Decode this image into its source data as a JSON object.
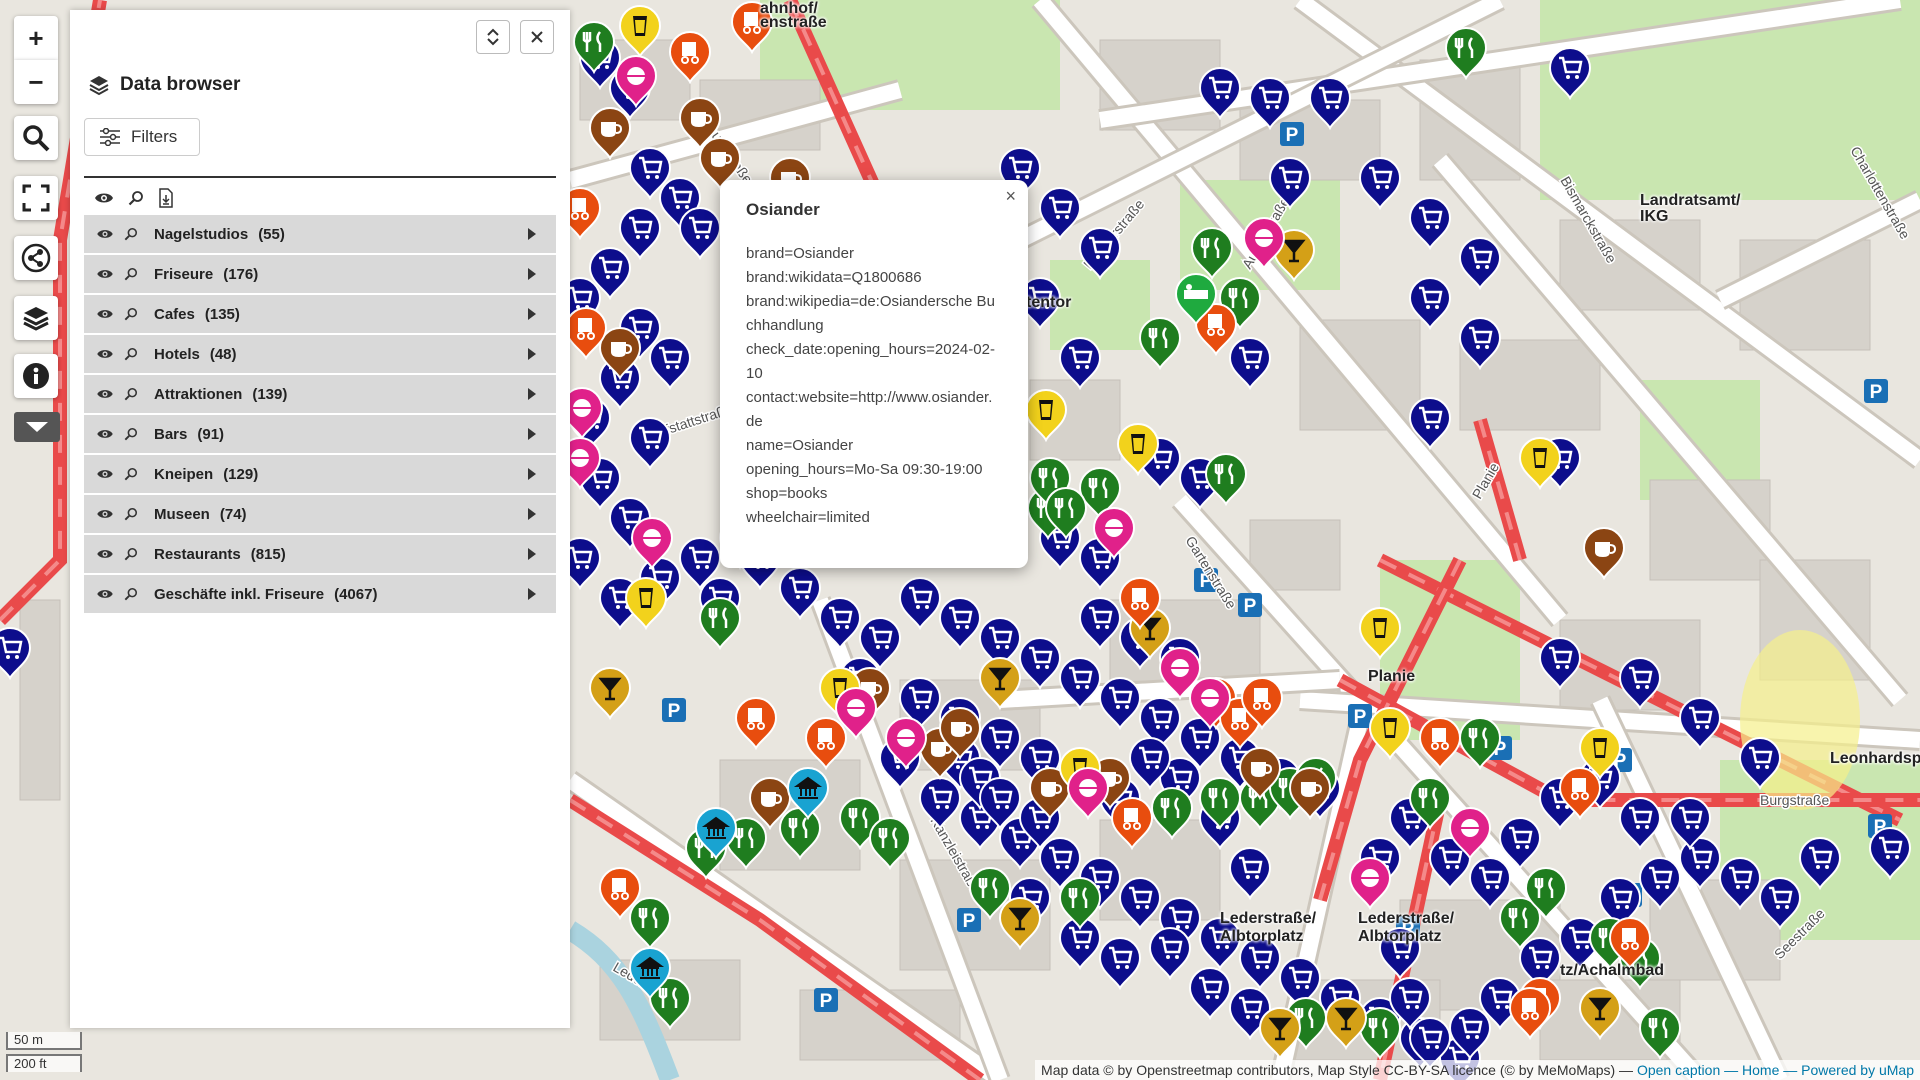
{
  "map": {
    "labels": [
      "Landratsamt/",
      "IKG",
      "Planie",
      "Leonhardsp",
      "Lederstraße/",
      "Albtorplatz",
      "Lederstraße/",
      "Albtorplatz",
      "tz/Achalmbad",
      "tentor",
      "ahnhof/",
      "enstraße"
    ],
    "streets": [
      "Hofstattstraße",
      "Mauerstraße",
      "Krämerstraße",
      "Bismarckstraße",
      "Aulberstraße",
      "Gartenstraße",
      "Burgstraße",
      "Kanzleistraße",
      "Lederstraße",
      "Seestraße",
      "Planie",
      "Charlottenstraße"
    ]
  },
  "controls": {
    "zoom_in": "+",
    "zoom_out": "−"
  },
  "panel": {
    "title": "Data browser",
    "filters_label": "Filters",
    "layers": [
      {
        "name": "Nagelstudios",
        "count": "(55)"
      },
      {
        "name": "Friseure",
        "count": "(176)"
      },
      {
        "name": "Cafes",
        "count": "(135)"
      },
      {
        "name": "Hotels",
        "count": "(48)"
      },
      {
        "name": "Attraktionen",
        "count": "(139)"
      },
      {
        "name": "Bars",
        "count": "(91)"
      },
      {
        "name": "Kneipen",
        "count": "(129)"
      },
      {
        "name": "Museen",
        "count": "(74)"
      },
      {
        "name": "Restaurants",
        "count": "(815)"
      },
      {
        "name": "Geschäfte inkl. Friseure",
        "count": "(4067)"
      }
    ]
  },
  "popup": {
    "title": "Osiander",
    "close": "×",
    "lines": [
      "brand=Osiander",
      "brand:wikidata=Q1800686",
      "brand:wikipedia=de:Osiandersche Buchhandlung",
      "check_date:opening_hours=2024-02-10",
      "contact:website=http://www.osiander.de",
      "name=Osiander",
      "opening_hours=Mo-Sa 09:30-19:00",
      "shop=books",
      "wheelchair=limited"
    ]
  },
  "scale": {
    "metric": "50 m",
    "imperial": "200 ft"
  },
  "attribution": {
    "text": "Map data © by Openstreetmap contributors, Map Style CC-BY-SA licence (© by MeMoMaps) —",
    "open_caption": "Open caption",
    "home": "— Home",
    "powered": "— Powered by uMap"
  },
  "colors": {
    "shop": "#0d0d8c",
    "restaurant": "#1f7d1f",
    "cafe": "#8b4513",
    "bar": "#f2d21c",
    "kneipe": "#d4a017",
    "friseur": "#e84d0e",
    "nagel": "#e0218a",
    "museum": "#19a3d1",
    "hotel": "#1faa3f"
  }
}
